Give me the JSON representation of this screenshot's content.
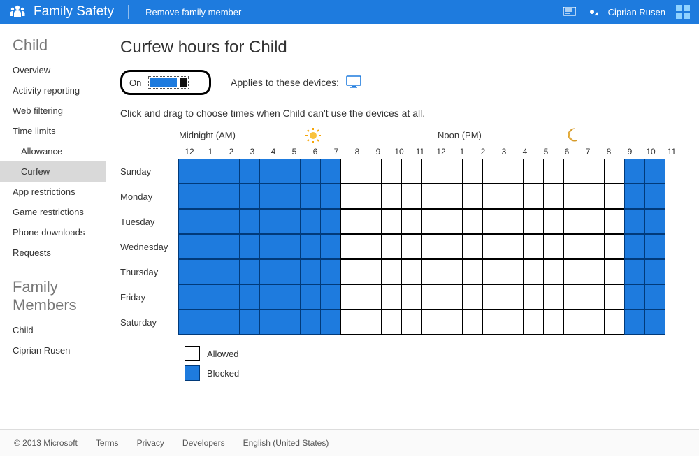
{
  "topbar": {
    "app_title": "Family Safety",
    "remove_link": "Remove family member",
    "user_name": "Ciprian Rusen"
  },
  "sidebar": {
    "heading1": "Child",
    "items1": [
      {
        "label": "Overview",
        "active": false,
        "indent": false
      },
      {
        "label": "Activity reporting",
        "active": false,
        "indent": false
      },
      {
        "label": "Web filtering",
        "active": false,
        "indent": false
      },
      {
        "label": "Time limits",
        "active": false,
        "indent": false
      },
      {
        "label": "Allowance",
        "active": false,
        "indent": true
      },
      {
        "label": "Curfew",
        "active": true,
        "indent": true
      },
      {
        "label": "App restrictions",
        "active": false,
        "indent": false
      },
      {
        "label": "Game restrictions",
        "active": false,
        "indent": false
      },
      {
        "label": "Phone downloads",
        "active": false,
        "indent": false
      },
      {
        "label": "Requests",
        "active": false,
        "indent": false
      }
    ],
    "heading2": "Family Members",
    "items2": [
      {
        "label": "Child"
      },
      {
        "label": "Ciprian Rusen"
      }
    ]
  },
  "main": {
    "page_title": "Curfew hours for Child",
    "toggle_state": "On",
    "applies_label": "Applies to these devices:",
    "hint": "Click and drag to choose times when Child can't use the devices at all.",
    "period_am": "Midnight (AM)",
    "period_pm": "Noon (PM)",
    "hours": [
      "12",
      "1",
      "2",
      "3",
      "4",
      "5",
      "6",
      "7",
      "8",
      "9",
      "10",
      "11",
      "12",
      "1",
      "2",
      "3",
      "4",
      "5",
      "6",
      "7",
      "8",
      "9",
      "10",
      "11"
    ],
    "days": [
      "Sunday",
      "Monday",
      "Tuesday",
      "Wednesday",
      "Thursday",
      "Friday",
      "Saturday"
    ],
    "blocked_hours": {
      "Sunday": [
        0,
        1,
        2,
        3,
        4,
        5,
        6,
        7,
        22,
        23
      ],
      "Monday": [
        0,
        1,
        2,
        3,
        4,
        5,
        6,
        7,
        22,
        23
      ],
      "Tuesday": [
        0,
        1,
        2,
        3,
        4,
        5,
        6,
        7,
        22,
        23
      ],
      "Wednesday": [
        0,
        1,
        2,
        3,
        4,
        5,
        6,
        7,
        22,
        23
      ],
      "Thursday": [
        0,
        1,
        2,
        3,
        4,
        5,
        6,
        7,
        22,
        23
      ],
      "Friday": [
        0,
        1,
        2,
        3,
        4,
        5,
        6,
        7,
        22,
        23
      ],
      "Saturday": [
        0,
        1,
        2,
        3,
        4,
        5,
        6,
        7,
        22,
        23
      ]
    },
    "legend_allowed": "Allowed",
    "legend_blocked": "Blocked"
  },
  "footer": {
    "copyright": "© 2013 Microsoft",
    "links": [
      "Terms",
      "Privacy",
      "Developers",
      "English (United States)"
    ]
  }
}
